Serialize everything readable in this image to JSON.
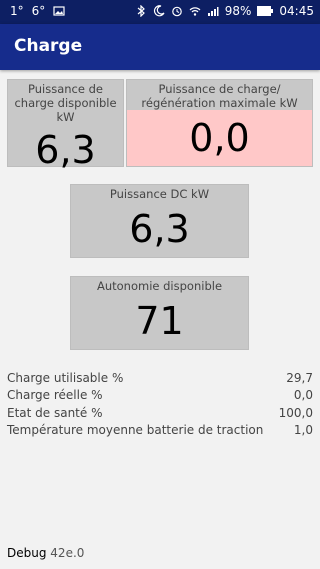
{
  "status_bar": {
    "left_items": [
      "1°",
      "6°"
    ],
    "battery": "98%",
    "time": "04:45"
  },
  "app_bar": {
    "title": "Charge"
  },
  "tiles": {
    "available_power": {
      "label": "Puissance de charge disponible kW",
      "value": "6,3"
    },
    "max_power": {
      "label": "Puissance de charge/ régénération maximale kW",
      "value": "0,0"
    },
    "dc_power": {
      "label": "Puissance DC kW",
      "value": "6,3"
    },
    "autonomy": {
      "label": "Autonomie disponible",
      "value": "71"
    }
  },
  "rows": [
    {
      "label": "Charge utilisable %",
      "value": "29,7"
    },
    {
      "label": "Charge réelle %",
      "value": "0,0"
    },
    {
      "label": "Etat de santé %",
      "value": "100,0"
    },
    {
      "label": "Température moyenne batterie de traction",
      "value": "1,0"
    }
  ],
  "footer": {
    "label": "Debug",
    "version": "42e.0"
  },
  "colors": {
    "status_bar": "#0d1f63",
    "app_bar": "#162c8c",
    "tile": "#c8c8c8",
    "tile_alert": "#ffc8c8"
  },
  "icons": [
    "image-icon",
    "bluetooth-icon",
    "moon-icon",
    "alarm-icon",
    "wifi-icon",
    "signal-icon",
    "battery-icon"
  ]
}
